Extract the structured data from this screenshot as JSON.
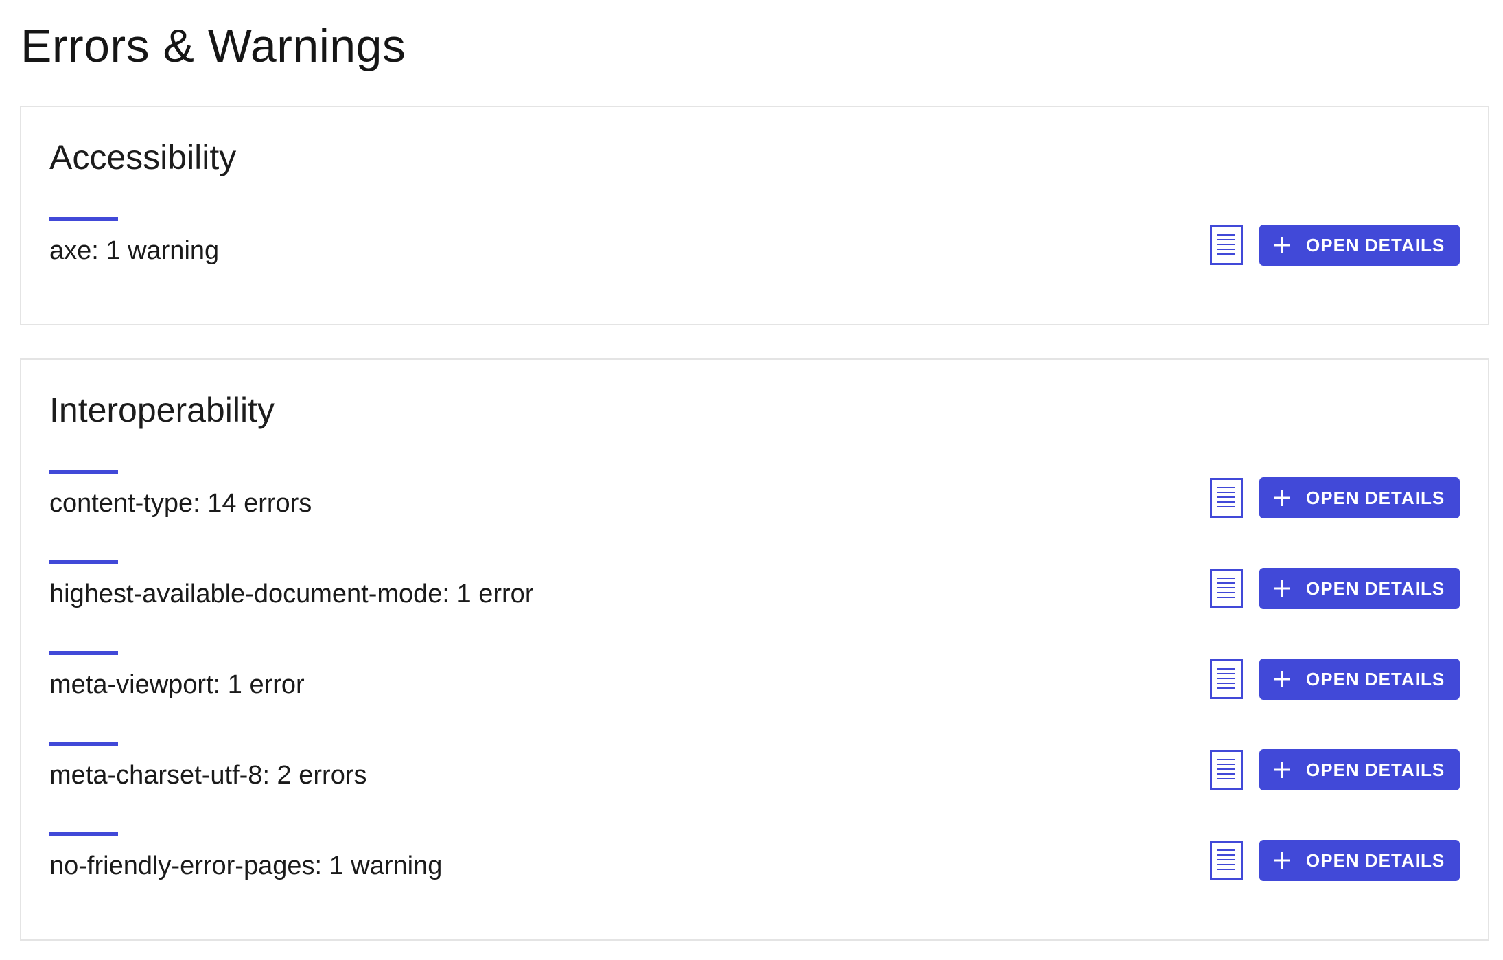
{
  "page": {
    "title": "Errors & Warnings"
  },
  "colors": {
    "accent": "#4149d8",
    "border": "#e4e4e4",
    "text": "#1a1a1a"
  },
  "icons": {
    "report": "document-icon",
    "expand": "plus-icon"
  },
  "sections": [
    {
      "title": "Accessibility",
      "items": [
        {
          "label": "axe: 1 warning",
          "button_label": "OPEN DETAILS"
        }
      ]
    },
    {
      "title": "Interoperability",
      "items": [
        {
          "label": "content-type: 14 errors",
          "button_label": "OPEN DETAILS"
        },
        {
          "label": "highest-available-document-mode: 1 error",
          "button_label": "OPEN DETAILS"
        },
        {
          "label": "meta-viewport: 1 error",
          "button_label": "OPEN DETAILS"
        },
        {
          "label": "meta-charset-utf-8: 2 errors",
          "button_label": "OPEN DETAILS"
        },
        {
          "label": "no-friendly-error-pages: 1 warning",
          "button_label": "OPEN DETAILS"
        }
      ]
    }
  ]
}
